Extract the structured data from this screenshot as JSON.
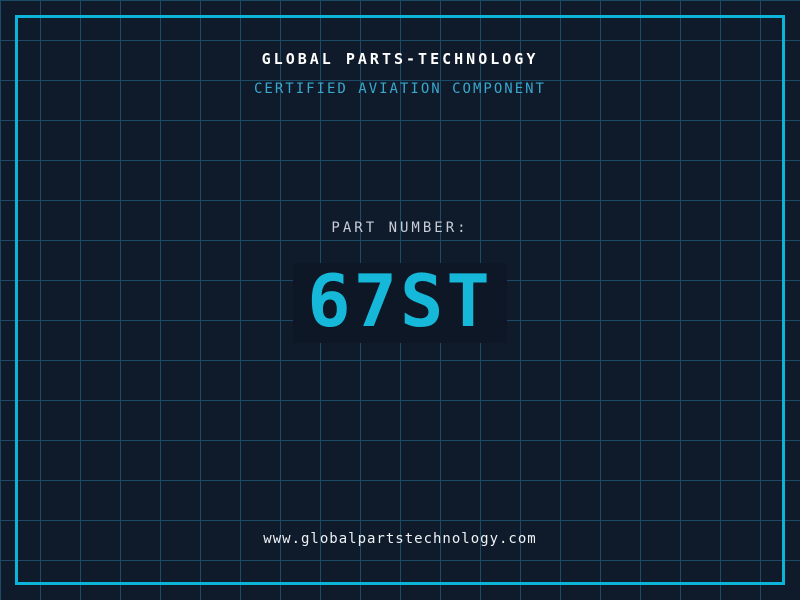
{
  "header": {
    "title": "GLOBAL PARTS-TECHNOLOGY",
    "subtitle": "CERTIFIED AVIATION COMPONENT"
  },
  "part": {
    "label": "PART NUMBER:",
    "number": "67ST"
  },
  "footer": {
    "url": "www.globalpartstechnology.com"
  },
  "colors": {
    "background": "#0f1a2a",
    "grid_line": "#1b4b66",
    "frame_border": "#0db4d9",
    "title_text": "#ffffff",
    "subtitle_text": "#38a8cd",
    "label_text": "#c7ced8",
    "part_number_text": "#16b8da",
    "url_text": "#eef2f5"
  }
}
